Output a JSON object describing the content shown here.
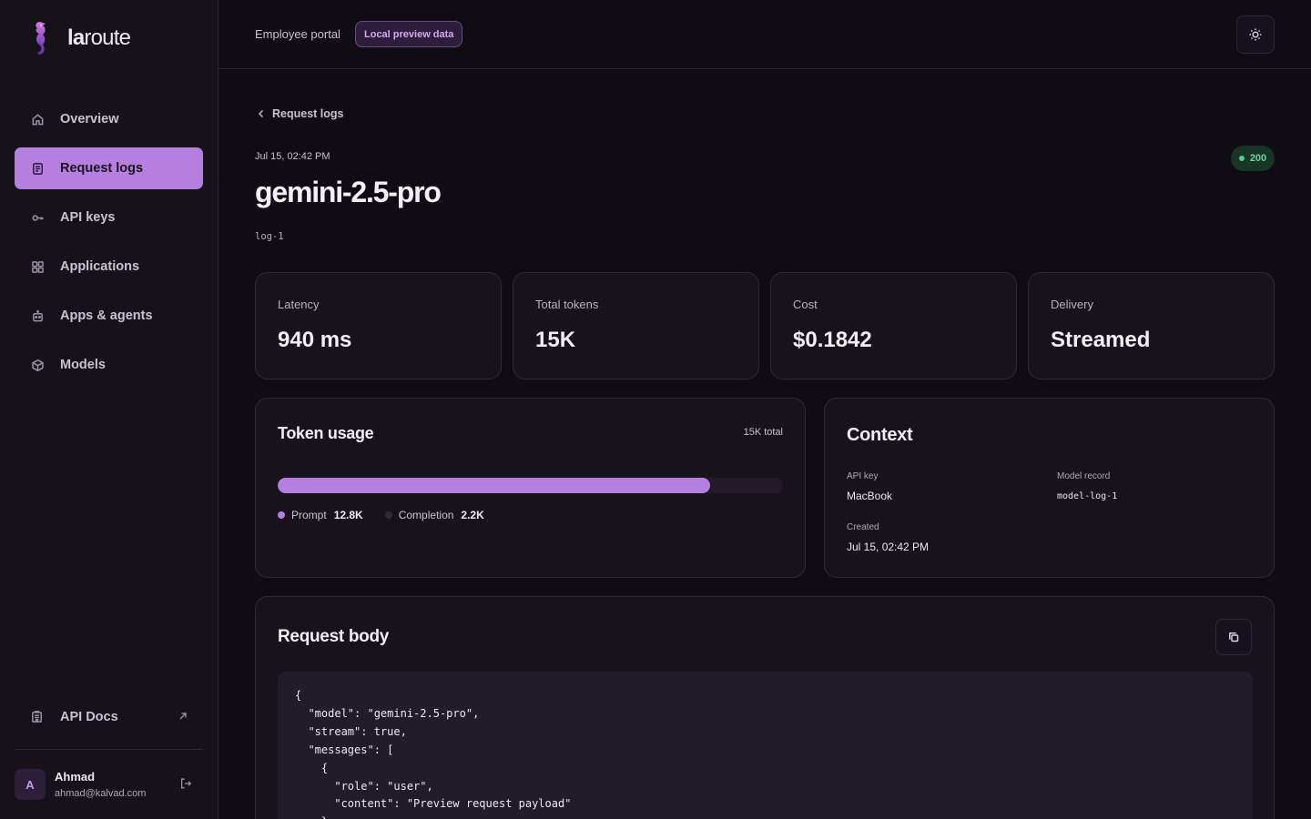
{
  "brand": {
    "name_bold": "la",
    "name_rest": "route"
  },
  "sidebar": {
    "items": [
      {
        "label": "Overview",
        "icon": "home-icon",
        "active": false
      },
      {
        "label": "Request logs",
        "icon": "document-icon",
        "active": true
      },
      {
        "label": "API keys",
        "icon": "key-icon",
        "active": false
      },
      {
        "label": "Applications",
        "icon": "grid-icon",
        "active": false
      },
      {
        "label": "Apps & agents",
        "icon": "robot-icon",
        "active": false
      },
      {
        "label": "Models",
        "icon": "box-icon",
        "active": false
      }
    ],
    "docs_label": "API Docs",
    "user": {
      "initial": "A",
      "name": "Ahmad",
      "email": "ahmad@kalvad.com"
    }
  },
  "topbar": {
    "portal_label": "Employee portal",
    "badge": "Local preview data"
  },
  "breadcrumb": "Request logs",
  "log": {
    "timestamp": "Jul 15, 02:42 PM",
    "status": "200",
    "model": "gemini-2.5-pro",
    "id": "log-1"
  },
  "stats": [
    {
      "label": "Latency",
      "value": "940 ms"
    },
    {
      "label": "Total tokens",
      "value": "15K"
    },
    {
      "label": "Cost",
      "value": "$0.1842"
    },
    {
      "label": "Delivery",
      "value": "Streamed"
    }
  ],
  "token_usage": {
    "title": "Token usage",
    "total": "15K total",
    "prompt_fraction": 0.855,
    "prompt_label": "Prompt",
    "prompt_value": "12.8K",
    "completion_label": "Completion",
    "completion_value": "2.2K"
  },
  "context": {
    "title": "Context",
    "api_key_label": "API key",
    "api_key": "MacBook",
    "model_record_label": "Model record",
    "model_record": "model-log-1",
    "created_label": "Created",
    "created": "Jul 15, 02:42 PM"
  },
  "request_body": {
    "title": "Request body",
    "code": "{\n  \"model\": \"gemini-2.5-pro\",\n  \"stream\": true,\n  \"messages\": [\n    {\n      \"role\": \"user\",\n      \"content\": \"Preview request payload\"\n    }\n  ]\n}"
  },
  "colors": {
    "accent": "#b57fdf",
    "background": "#0f0c13",
    "sidebar": "#171219",
    "card": "#18131b",
    "status_green": "#57c893"
  }
}
